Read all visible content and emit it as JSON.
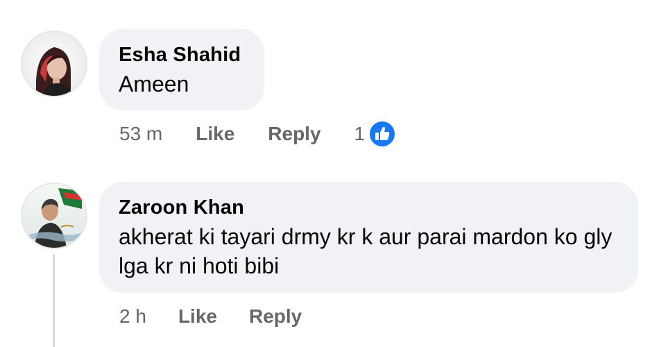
{
  "comments": [
    {
      "author": "Esha Shahid",
      "text": "Ameen",
      "time": "53 m",
      "like_label": "Like",
      "reply_label": "Reply",
      "reaction_count": "1",
      "reaction_icon": "like-thumb-icon"
    },
    {
      "author": "Zaroon Khan",
      "text": "akherat ki tayari drmy kr k aur parai mardon ko gly lga kr ni hoti bibi",
      "time": "2 h",
      "like_label": "Like",
      "reply_label": "Reply"
    }
  ],
  "colors": {
    "bubble_bg": "#f0f2f5",
    "action_text": "#65676b",
    "author_text": "#050505",
    "reaction_blue": "#1877f2"
  }
}
